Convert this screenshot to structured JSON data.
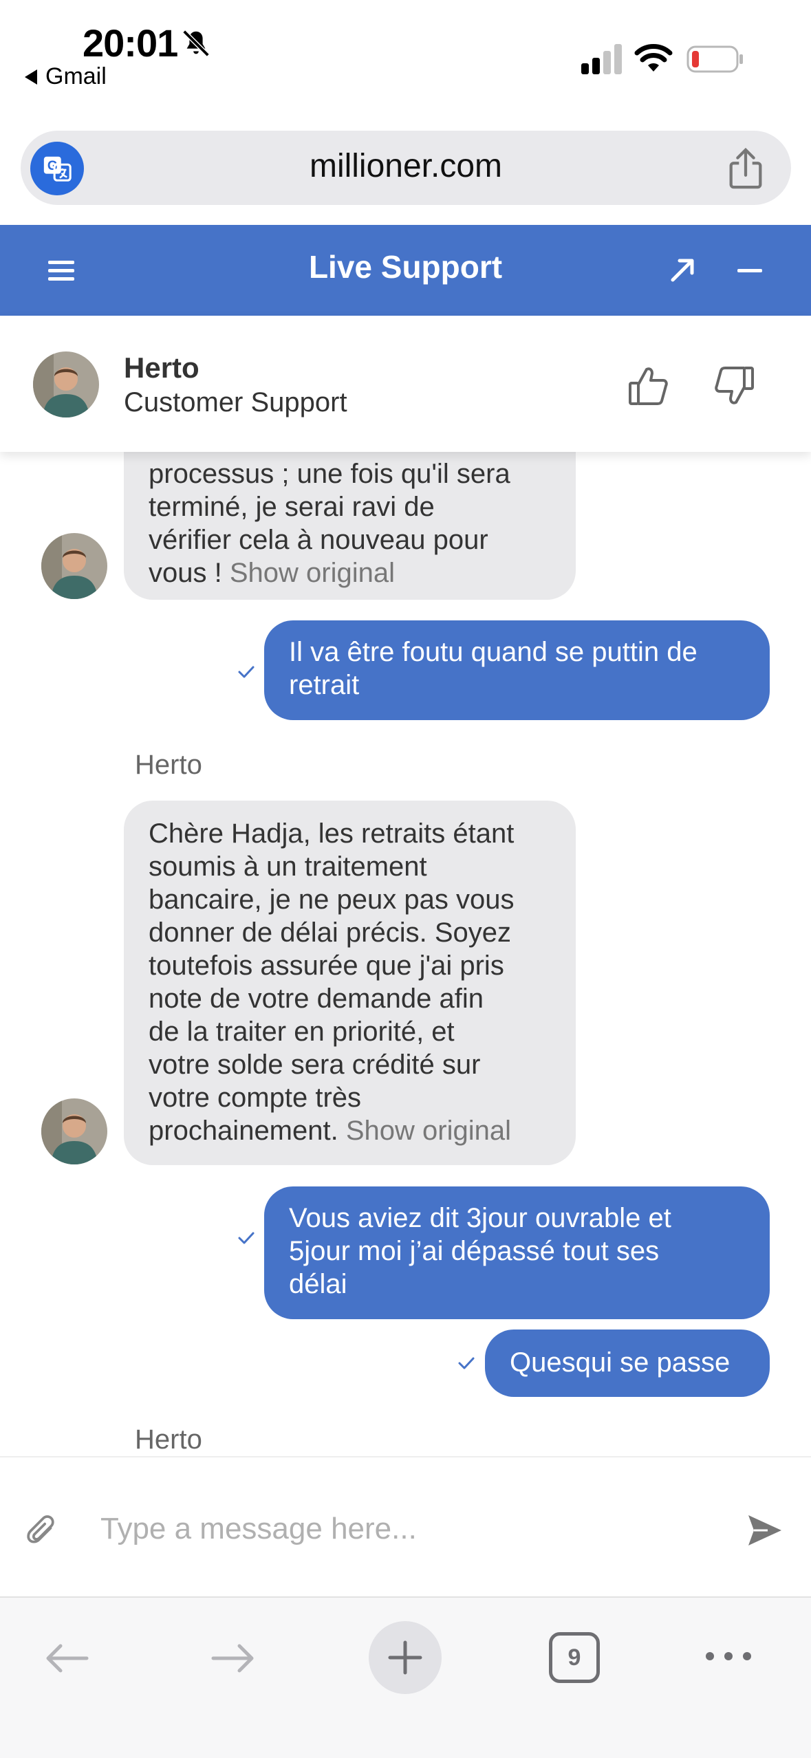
{
  "status_bar": {
    "time": "20:01",
    "back_label": "Gmail"
  },
  "browser": {
    "url": "millioner.com",
    "tab_count": "9"
  },
  "support": {
    "title": "Live Support"
  },
  "agent": {
    "name": "Herto",
    "role": "Customer Support"
  },
  "chat": {
    "show_original": "Show original",
    "messages": [
      {
        "from": "agent",
        "lines": [
          "processus ; une fois qu'il sera",
          "terminé, je serai ravi de",
          "vérifier cela à nouveau pour",
          "vous !"
        ]
      },
      {
        "from": "user",
        "lines": [
          "Il va être foutu quand se puttin de",
          "retrait"
        ]
      },
      {
        "from": "agent",
        "sender": "Herto",
        "lines": [
          "Chère Hadja, les retraits étant",
          "soumis à un traitement",
          "bancaire, je ne peux pas vous",
          "donner de délai précis. Soyez",
          "toutefois assurée que j'ai pris",
          "note de votre demande afin",
          "de la traiter en priorité, et",
          "votre solde sera crédité sur",
          "votre compte très",
          "prochainement."
        ]
      },
      {
        "from": "user",
        "lines": [
          "Vous aviez dit 3jour ouvrable et",
          "5jour moi j’ai dépassé tout ses",
          "délai"
        ]
      },
      {
        "from": "user",
        "lines": [
          "Quesqui se passe"
        ]
      },
      {
        "from": "agent",
        "sender": "Herto"
      }
    ]
  },
  "composer": {
    "placeholder": "Type a message here..."
  },
  "colors": {
    "accent": "#4673c8",
    "incoming_bubble": "#e9e9eb",
    "translate_button": "#2a6bdc",
    "battery_low": "#e53935"
  },
  "icons": [
    "bell-slash-icon",
    "signal-icon",
    "wifi-icon",
    "battery-icon",
    "translate-icon",
    "share-icon",
    "menu-icon",
    "expand-icon",
    "minimize-icon",
    "thumbs-up-icon",
    "thumbs-down-icon",
    "check-icon",
    "paperclip-icon",
    "send-icon",
    "back-arrow-icon",
    "forward-arrow-icon",
    "plus-icon",
    "tabs-icon",
    "more-icon"
  ]
}
